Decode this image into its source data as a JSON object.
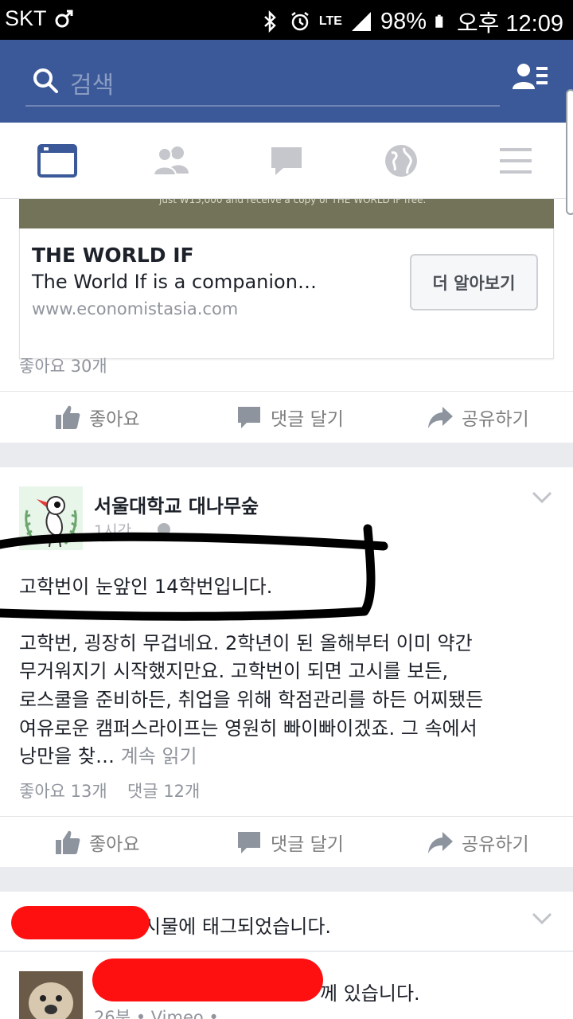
{
  "status_bar": {
    "carrier": "SKT",
    "network": "LTE",
    "battery": "98%",
    "time": "오후 12:09"
  },
  "search": {
    "placeholder": "검색"
  },
  "tabs": [
    {
      "name": "news-feed",
      "icon": "news-feed-icon",
      "active": true
    },
    {
      "name": "friend-requests",
      "icon": "friends-icon",
      "active": false
    },
    {
      "name": "messages",
      "icon": "chat-bubble-icon",
      "active": false
    },
    {
      "name": "notifications",
      "icon": "globe-icon",
      "active": false
    },
    {
      "name": "menu",
      "icon": "hamburger-menu-icon",
      "active": false
    }
  ],
  "ad_post": {
    "image_caption": "just ₩15,000 and receive a copy of THE WORLD IF free.",
    "link_title": "THE WORLD IF",
    "link_description": "The World If is a companion…",
    "link_url": "www.economistasia.com",
    "cta": "더 알아보기",
    "likes": "좋아요 30개"
  },
  "actions": {
    "like": "좋아요",
    "comment": "댓글 달기",
    "share": "공유하기"
  },
  "post": {
    "author": "서울대학교 대나무숲",
    "time": "1시간",
    "headline": "고학번이 눈앞인 14학번입니다.",
    "body_lines": [
      "고학번, 굉장히 무겁네요. 2학년이 된 올해부터 이미 약간",
      "무거워지기 시작했지만요. 고학번이 되면 고시를 보든,",
      "로스쿨을 준비하든, 취업을 위해 학점관리를 하든 어찌됐든",
      "여유로운 캠퍼스라이프는 영원히 빠이빠이겠죠. 그 속에서",
      "낭만을 찾…"
    ],
    "see_more": "계속 읽기",
    "likes": "좋아요 13개",
    "comments": "댓글 12개"
  },
  "tagged_post": {
    "tagged_text": "시물에 태그되었습니다.",
    "line2": "께 있습니다.",
    "meta": "26분 • Vimeo •"
  },
  "colors": {
    "facebook_blue": "#3b5998",
    "annotation_black": "#000000",
    "redaction_red": "#ff1010"
  }
}
